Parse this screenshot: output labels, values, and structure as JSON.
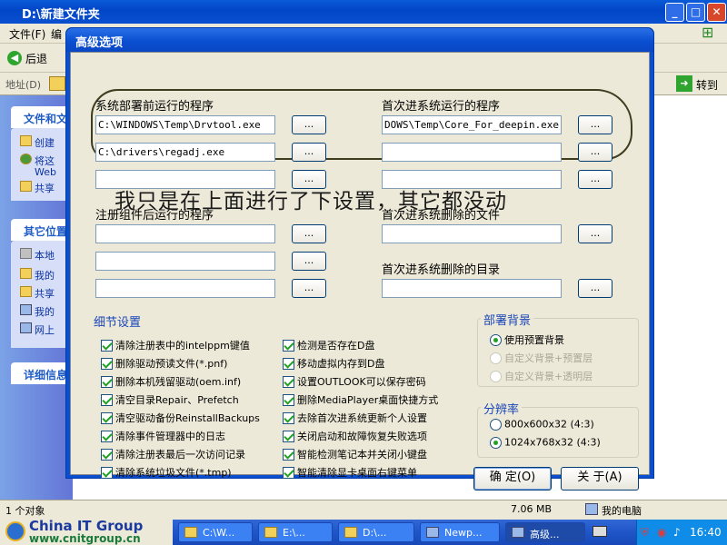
{
  "explorer": {
    "title": "D:\\新建文件夹",
    "menu": [
      "文件(F)",
      "编"
    ],
    "back_label": "后退",
    "address_label": "地址(D)",
    "go_label": "转到",
    "side_tasks_header": "文件和文",
    "side_tasks": [
      "创建",
      "将这",
      "Web",
      "共享"
    ],
    "other_header": "其它位置",
    "other_items": [
      "本地",
      "我的",
      "共享",
      "我的",
      "网上"
    ],
    "details_header": "详细信息",
    "status_left": "1 个对象",
    "status_size": "7.06 MB",
    "status_location": "我的电脑"
  },
  "taskbar": {
    "tasks": [
      "C:\\W...",
      "E:\\...",
      "D:\\...",
      "Newp...",
      "高级..."
    ],
    "clock": "16:40"
  },
  "watermark": {
    "brand": "China IT Group",
    "url": "www.cnitgroup.cn"
  },
  "dialog": {
    "title": "高级选项",
    "annotation": "我只是在上面进行了下设置，其它都没动",
    "pre_deploy_label": "系统部署前运行的程序",
    "pre_deploy": [
      "C:\\WINDOWS\\Temp\\Drvtool.exe",
      "C:\\drivers\\regadj.exe",
      ""
    ],
    "first_boot_label": "首次进系统运行的程序",
    "first_boot": [
      "DOWS\\Temp\\Core_For_deepin.exe /d",
      "",
      ""
    ],
    "post_register_label": "注册组件后运行的程序",
    "post_register": [
      "",
      "",
      ""
    ],
    "delete_files_label": "首次进系统删除的文件",
    "delete_files": [
      ""
    ],
    "delete_dirs_label": "首次进系统删除的目录",
    "delete_dirs": [
      ""
    ],
    "browse_label": "...",
    "details_label": "细节设置",
    "checks_left": [
      "清除注册表中的intelppm键值",
      "删除驱动预读文件(*.pnf)",
      "删除本机残留驱动(oem.inf)",
      "清空目录Repair、Prefetch",
      "清空驱动备份ReinstallBackups",
      "清除事件管理器中的日志",
      "清除注册表最后一次访问记录",
      "清除系统垃圾文件(*.tmp)"
    ],
    "checks_right": [
      "检测是否存在D盘",
      "移动虚拟内存到D盘",
      "设置OUTLOOK可以保存密码",
      "删除MediaPlayer桌面快捷方式",
      "去除首次进系统更新个人设置",
      "关闭启动和故障恢复失败选项",
      "智能检测笔记本并关闭小键盘",
      "智能清除显卡桌面右键菜单"
    ],
    "background_label": "部署背景",
    "background_options": [
      "使用预置背景",
      "自定义背景+预置层",
      "自定义背景+透明层"
    ],
    "resolution_label": "分辨率",
    "resolution_options": [
      "800x600x32  (4:3)",
      "1024x768x32  (4:3)"
    ],
    "ok_label": "确 定(O)",
    "about_label": "关 于(A)"
  }
}
